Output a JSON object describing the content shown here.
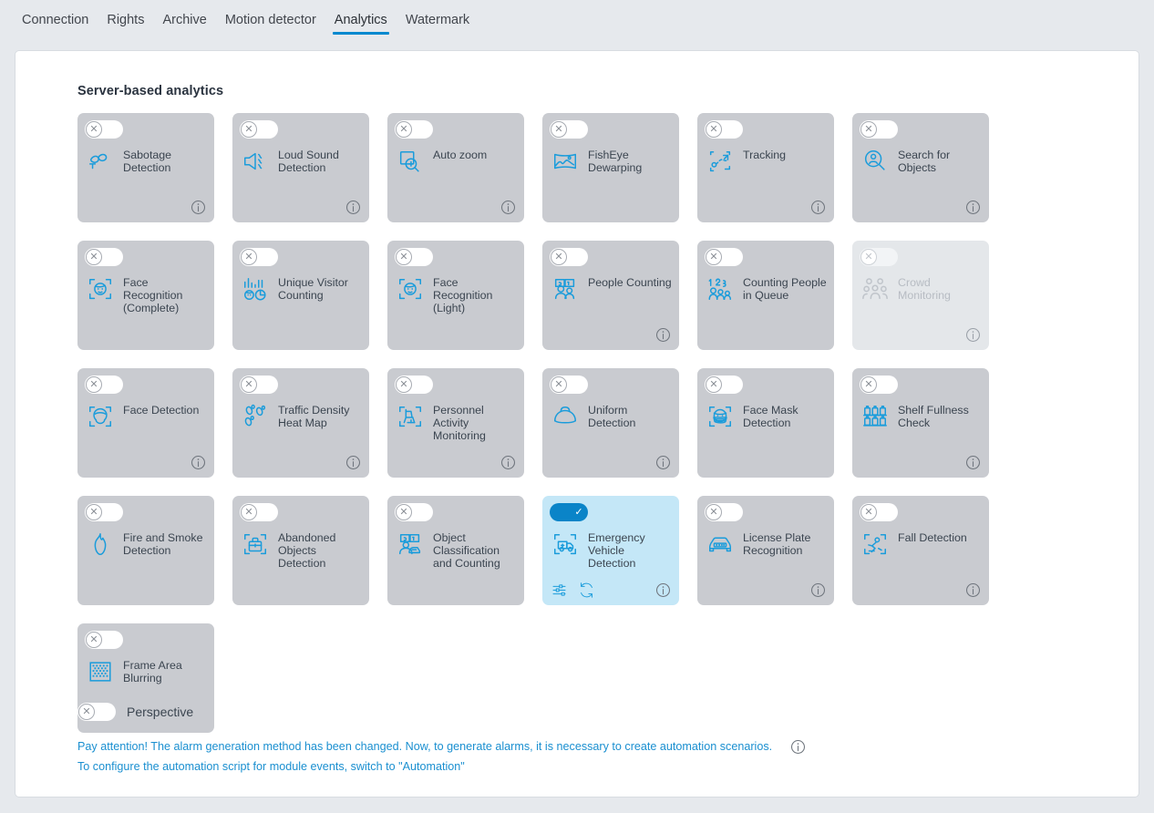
{
  "tabs": [
    {
      "label": "Connection",
      "active": false
    },
    {
      "label": "Rights",
      "active": false
    },
    {
      "label": "Archive",
      "active": false
    },
    {
      "label": "Motion detector",
      "active": false
    },
    {
      "label": "Analytics",
      "active": true
    },
    {
      "label": "Watermark",
      "active": false
    }
  ],
  "section": {
    "title": "Server-based analytics"
  },
  "colors": {
    "accent": "#0089cf",
    "icon_blue": "#1a9cdb",
    "card_bg": "#c9cbd0",
    "card_bg_enabled": "#c4e7f7",
    "card_bg_disabled": "#e4e7ea",
    "page_bg": "#e6e9ed",
    "panel_bg": "#ffffff",
    "text": "#3b4550",
    "link": "#1a8fd0"
  },
  "cards": [
    {
      "label": "Sabotage Detection",
      "icon": "sabotage-icon",
      "state": "off",
      "info": true,
      "extras": []
    },
    {
      "label": "Loud Sound Detection",
      "icon": "loud-sound-icon",
      "state": "off",
      "info": true,
      "extras": []
    },
    {
      "label": "Auto zoom",
      "icon": "auto-zoom-icon",
      "state": "off",
      "info": true,
      "extras": []
    },
    {
      "label": "FishEye Dewarping",
      "icon": "fisheye-dewarping-icon",
      "state": "off",
      "info": false,
      "extras": []
    },
    {
      "label": "Tracking",
      "icon": "tracking-icon",
      "state": "off",
      "info": true,
      "extras": []
    },
    {
      "label": "Search for Objects",
      "icon": "search-objects-icon",
      "state": "off",
      "info": true,
      "extras": []
    },
    {
      "label": "Face Recognition (Complete)",
      "icon": "face-recognition-icon",
      "state": "off",
      "info": false,
      "extras": []
    },
    {
      "label": "Unique Visitor Counting",
      "icon": "unique-visitor-counting-icon",
      "state": "off",
      "info": false,
      "extras": []
    },
    {
      "label": "Face Recognition (Light)",
      "icon": "face-recognition-icon",
      "state": "off",
      "info": false,
      "extras": []
    },
    {
      "label": "People Counting",
      "icon": "people-counting-icon",
      "state": "off",
      "info": true,
      "extras": []
    },
    {
      "label": "Counting People in Queue",
      "icon": "counting-queue-icon",
      "state": "off",
      "info": false,
      "extras": []
    },
    {
      "label": "Crowd Monitoring",
      "icon": "crowd-monitoring-icon",
      "state": "disabled",
      "info": true,
      "extras": []
    },
    {
      "label": "Face Detection",
      "icon": "face-detection-icon",
      "state": "off",
      "info": true,
      "extras": []
    },
    {
      "label": "Traffic Density Heat Map",
      "icon": "heatmap-footprints-icon",
      "state": "off",
      "info": true,
      "extras": []
    },
    {
      "label": "Personnel Activity Monitoring",
      "icon": "personnel-activity-icon",
      "state": "off",
      "info": true,
      "extras": []
    },
    {
      "label": "Uniform Detection",
      "icon": "uniform-helmet-icon",
      "state": "off",
      "info": true,
      "extras": []
    },
    {
      "label": "Face Mask Detection",
      "icon": "face-mask-icon",
      "state": "off",
      "info": false,
      "extras": []
    },
    {
      "label": "Shelf Fullness Check",
      "icon": "shelf-fullness-icon",
      "state": "off",
      "info": true,
      "extras": []
    },
    {
      "label": "Fire and Smoke Detection",
      "icon": "fire-smoke-icon",
      "state": "off",
      "info": false,
      "extras": []
    },
    {
      "label": "Abandoned Objects Detection",
      "icon": "abandoned-objects-icon",
      "state": "off",
      "info": false,
      "extras": []
    },
    {
      "label": "Object Classification and Counting",
      "icon": "object-classification-icon",
      "state": "off",
      "info": false,
      "extras": []
    },
    {
      "label": "Emergency Vehicle Detection",
      "icon": "emergency-vehicle-icon",
      "state": "on",
      "info": true,
      "extras": [
        "settings-sliders-icon",
        "refresh-icon"
      ]
    },
    {
      "label": "License Plate Recognition",
      "icon": "license-plate-icon",
      "state": "off",
      "info": true,
      "extras": []
    },
    {
      "label": "Fall Detection",
      "icon": "fall-detection-icon",
      "state": "off",
      "info": true,
      "extras": []
    },
    {
      "label": "Frame Area Blurring",
      "icon": "frame-blurring-icon",
      "state": "off",
      "info": false,
      "extras": []
    }
  ],
  "perspective": {
    "label": "Perspective",
    "state": "off"
  },
  "notice": {
    "line1": "Pay attention! The alarm generation method has been changed. Now, to generate alarms, it is necessary to create automation scenarios.",
    "line2": "To configure the automation script for module events, switch to \"Automation\""
  }
}
